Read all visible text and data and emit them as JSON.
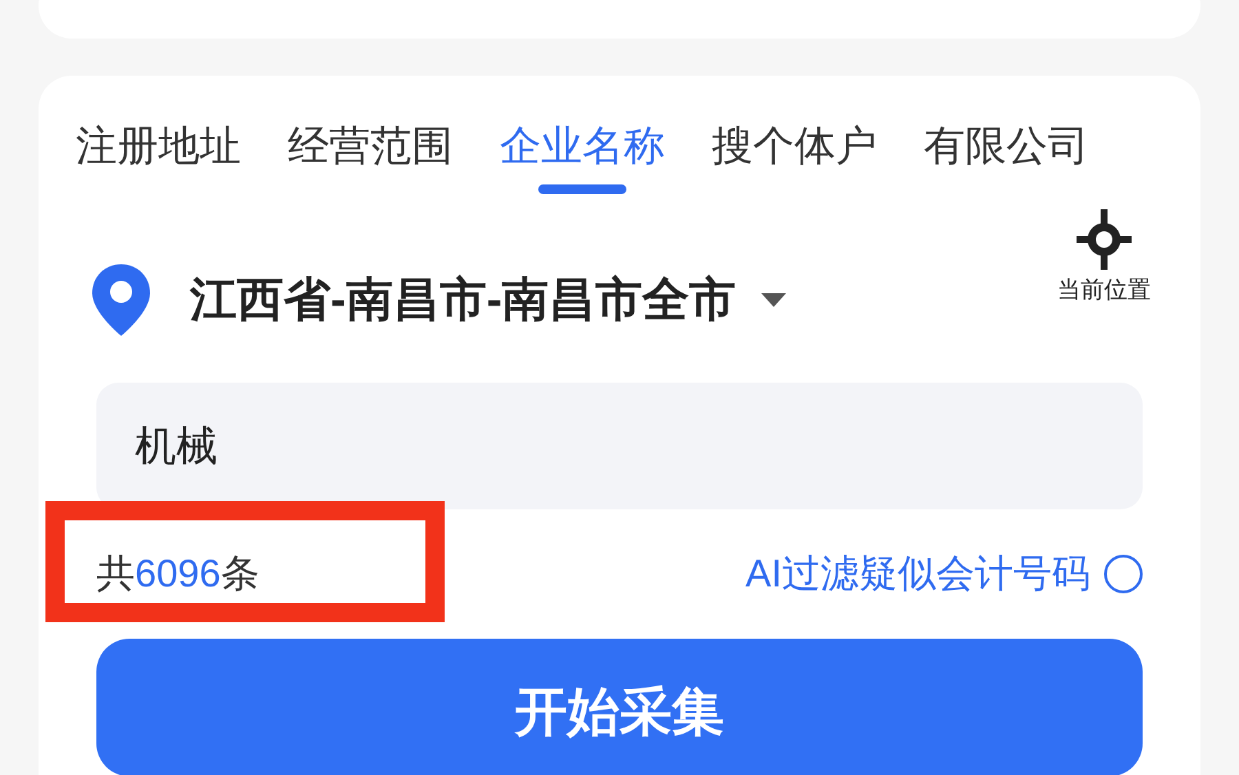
{
  "tabs": [
    {
      "label": "注册地址",
      "selected": false
    },
    {
      "label": "经营范围",
      "selected": false
    },
    {
      "label": "企业名称",
      "selected": true
    },
    {
      "label": "搜个体户",
      "selected": false
    },
    {
      "label": "有限公司",
      "selected": false
    }
  ],
  "location": {
    "text": "江西省-南昌市-南昌市全市",
    "current_position_label": "当前位置"
  },
  "search": {
    "value": "机械"
  },
  "count": {
    "prefix": "共",
    "number": "6096",
    "suffix": "条"
  },
  "ai_filter": {
    "label": "AI过滤疑似会计号码",
    "checked": false
  },
  "start_button": {
    "label": "开始采集"
  },
  "highlight": {
    "kind": "annotation-frame"
  }
}
